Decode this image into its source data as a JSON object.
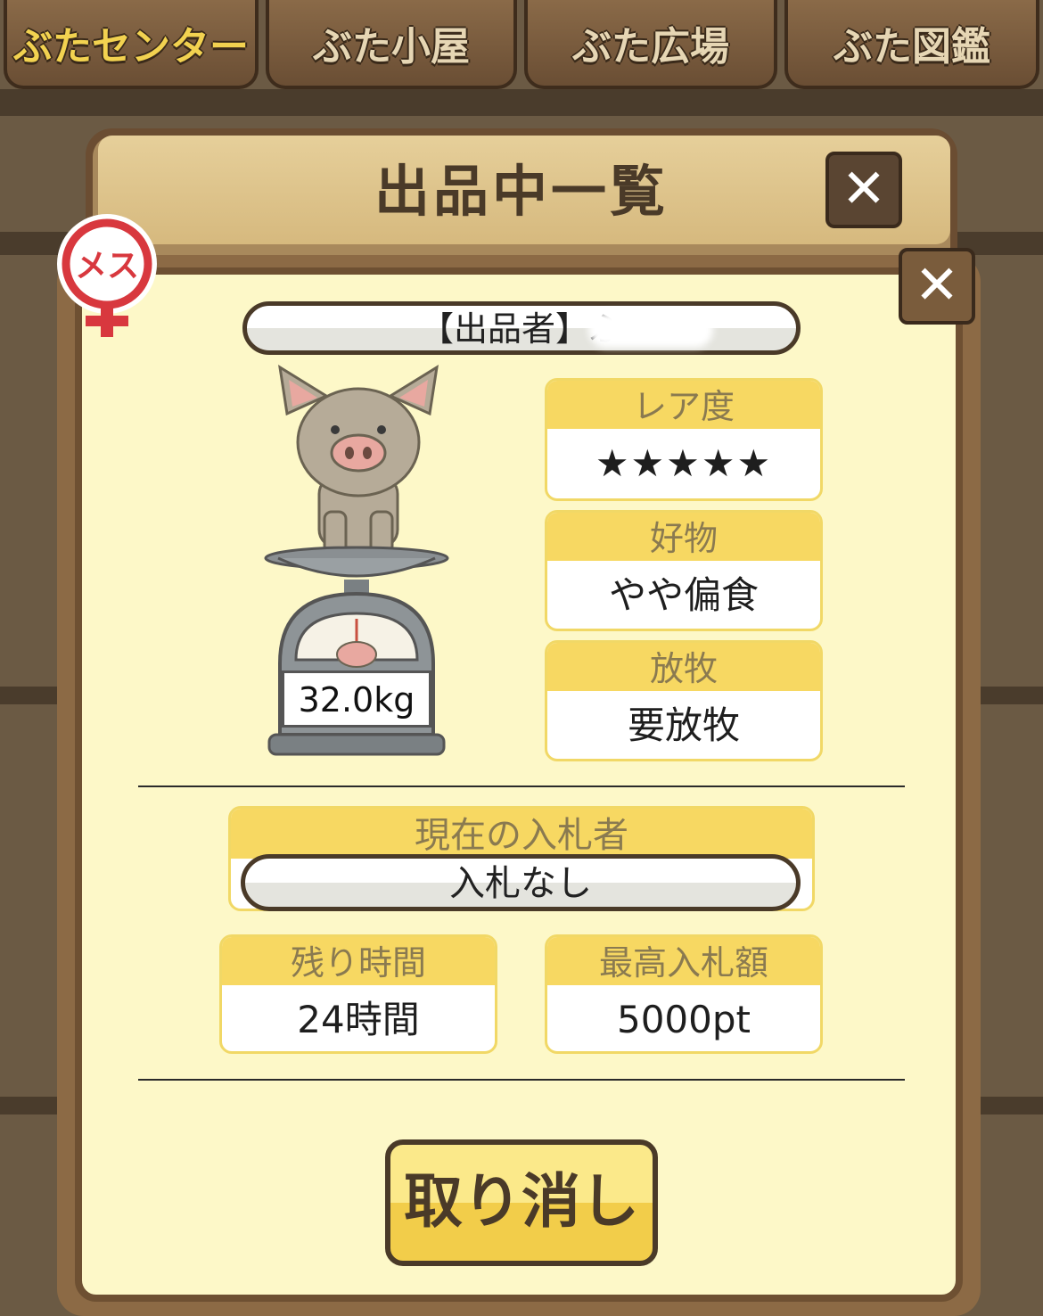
{
  "tabs": [
    {
      "label": "ぶたセンター",
      "active": true
    },
    {
      "label": "ぶた小屋",
      "active": false
    },
    {
      "label": "ぶた広場",
      "active": false
    },
    {
      "label": "ぶた図鑑",
      "active": false
    }
  ],
  "dialog": {
    "title": "出品中一覧",
    "close_label": "✕"
  },
  "listing": {
    "gender_badge": "メス",
    "seller_label": "【出品者】ふ",
    "close_label": "✕",
    "weight": "32.0kg",
    "rarity": {
      "label": "レア度",
      "stars": "★★★★★",
      "value": 5
    },
    "favorite": {
      "label": "好物",
      "value": "やや偏食"
    },
    "grazing": {
      "label": "放牧",
      "value": "要放牧"
    },
    "bidder": {
      "label": "現在の入札者",
      "value": "入札なし"
    },
    "time_left": {
      "label": "残り時間",
      "value": "24時間"
    },
    "top_bid": {
      "label": "最高入札額",
      "value": "5000pt"
    },
    "cancel_button": "取り消し"
  },
  "colors": {
    "header_yellow": "#f7d862",
    "star_pink": "#e98a82",
    "card_bg": "#fdf8c8",
    "frame_brown": "#6e5032"
  }
}
